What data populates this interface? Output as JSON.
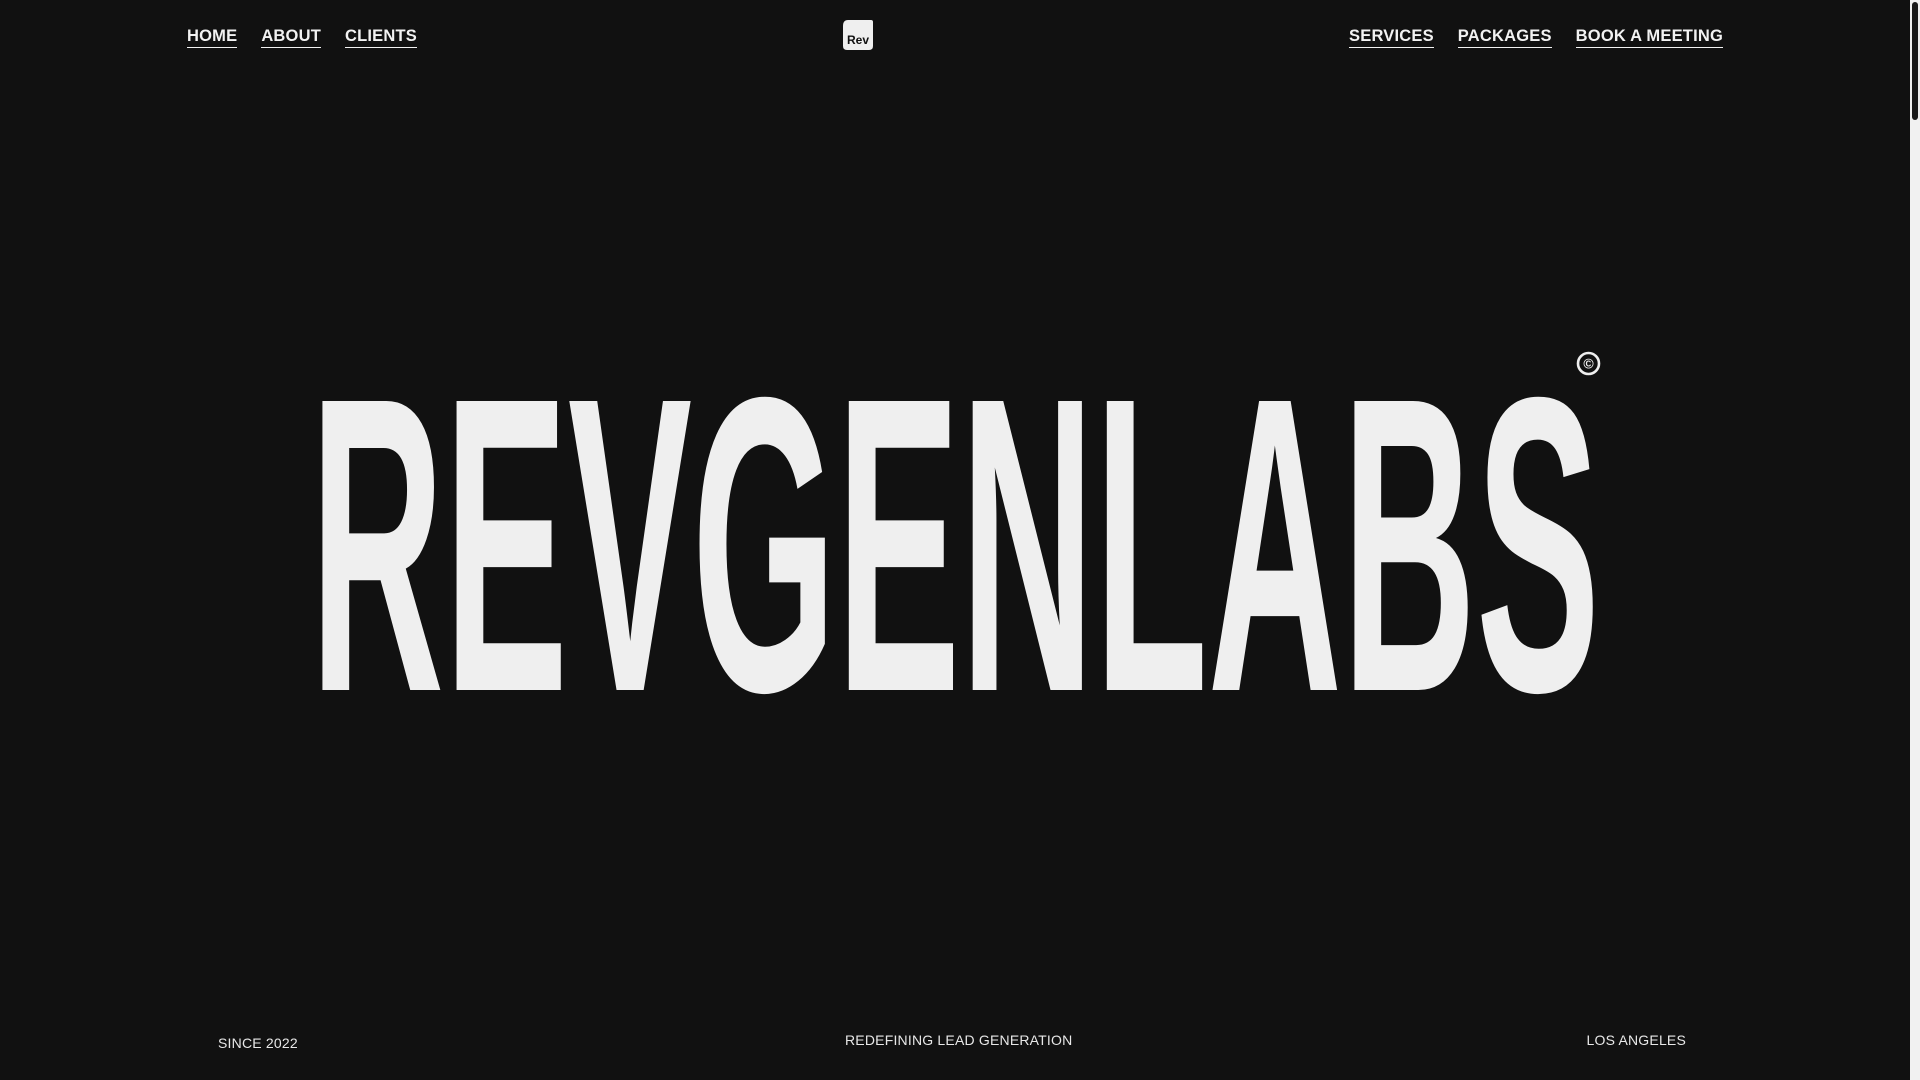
{
  "nav": {
    "left": [
      {
        "label": "HOME"
      },
      {
        "label": "ABOUT"
      },
      {
        "label": "CLIENTS"
      }
    ],
    "right": [
      {
        "label": "SERVICES"
      },
      {
        "label": "PACKAGES"
      },
      {
        "label": "BOOK A MEETING"
      }
    ]
  },
  "logo": {
    "text": "Rev",
    "icon": "rev-logo-icon"
  },
  "hero": {
    "wordmark": "REVGENLABS",
    "mark": "©"
  },
  "footer": {
    "since": "SINCE 2022",
    "tagline": "REDEFINING LEAD GENERATION",
    "location": "LOS ANGELES"
  },
  "colors": {
    "background": "#111111",
    "foreground": "#efefef",
    "scrollbar_track": "#f1f1f1",
    "scrollbar_thumb": "#1a1a1a"
  }
}
